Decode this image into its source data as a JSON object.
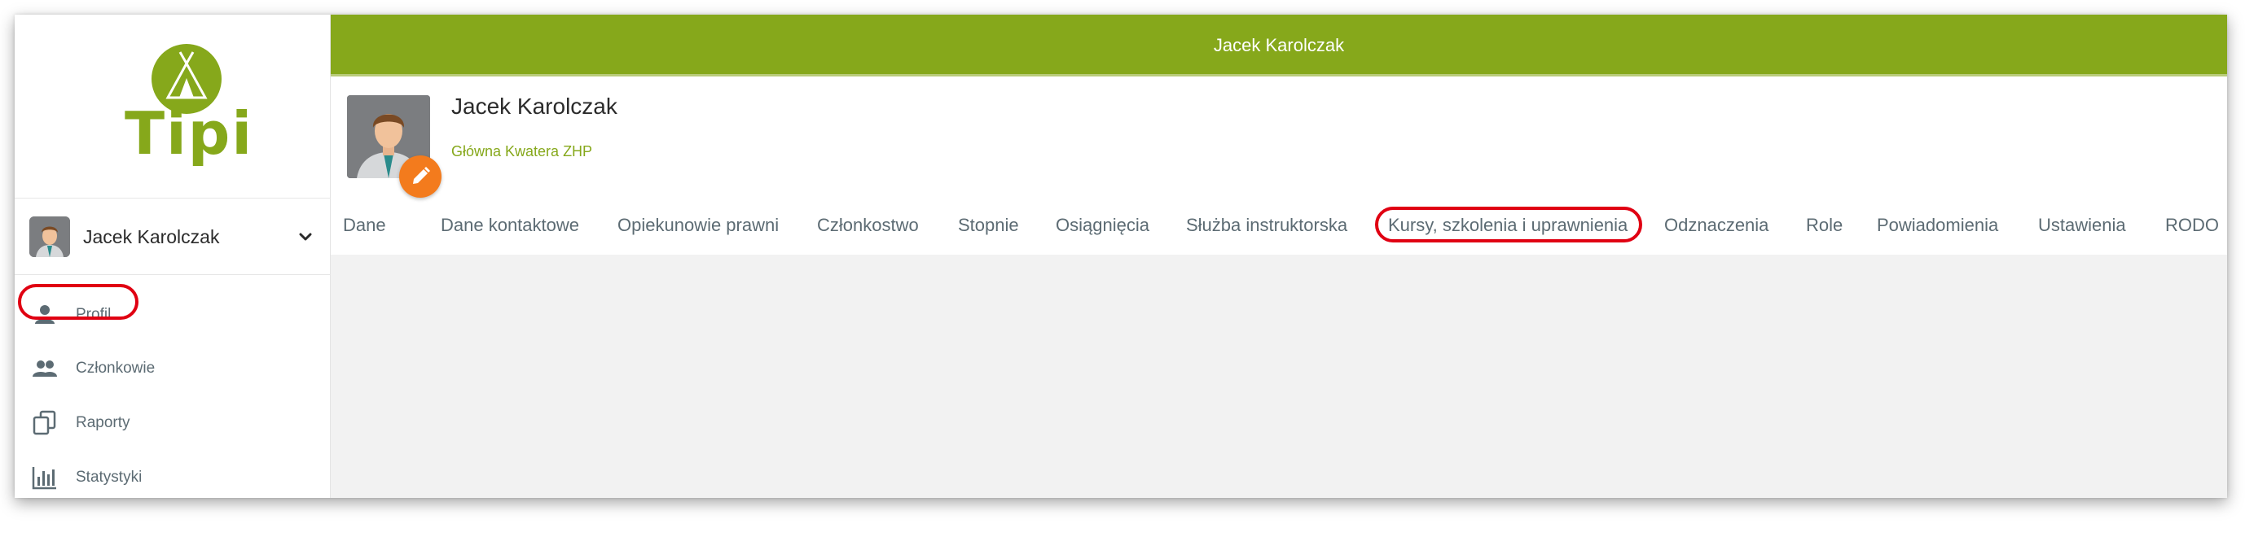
{
  "app": {
    "logo_text": "Tipi",
    "brand_color": "#86a81b",
    "accent_color": "#f37b1d",
    "highlight_color": "#e00012"
  },
  "sidebar": {
    "user": {
      "name": "Jacek Karolczak"
    },
    "items": [
      {
        "label": "Profil",
        "icon": "person-icon"
      },
      {
        "label": "Członkowie",
        "icon": "people-icon"
      },
      {
        "label": "Raporty",
        "icon": "documents-icon"
      },
      {
        "label": "Statystyki",
        "icon": "bar-chart-icon"
      }
    ]
  },
  "header": {
    "title": "Jacek Karolczak"
  },
  "profile": {
    "name": "Jacek Karolczak",
    "unit": "Główna Kwatera ZHP",
    "tabs": [
      {
        "label": "Dane"
      },
      {
        "label": "Dane kontaktowe"
      },
      {
        "label": "Opiekunowie prawni"
      },
      {
        "label": "Członkostwo"
      },
      {
        "label": "Stopnie"
      },
      {
        "label": "Osiągnięcia"
      },
      {
        "label": "Służba instruktorska"
      },
      {
        "label": "Kursy, szkolenia i uprawnienia"
      },
      {
        "label": "Odznaczenia"
      },
      {
        "label": "Role"
      },
      {
        "label": "Powiadomienia"
      },
      {
        "label": "Ustawienia"
      },
      {
        "label": "RODO"
      }
    ]
  }
}
